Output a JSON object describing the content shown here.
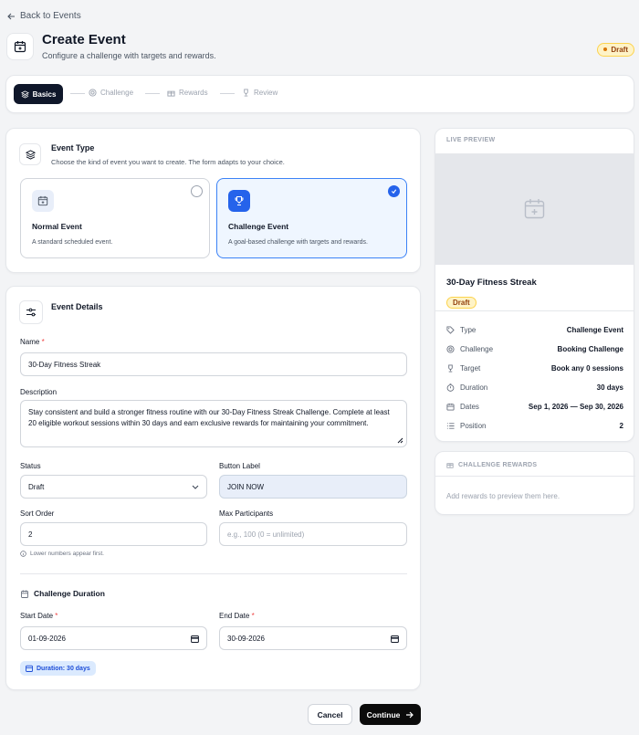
{
  "nav": {
    "back_label": "Back to Events"
  },
  "header": {
    "title": "Create Event",
    "subtitle": "Configure a challenge with targets and rewards.",
    "status_badge": "Draft"
  },
  "steps": [
    {
      "label": "Basics",
      "active": true
    },
    {
      "label": "Challenge",
      "active": false
    },
    {
      "label": "Rewards",
      "active": false
    },
    {
      "label": "Review",
      "active": false
    }
  ],
  "event_type": {
    "title": "Event Type",
    "subtitle": "Choose the kind of event you want to create. The form adapts to your choice.",
    "options": [
      {
        "name": "Normal Event",
        "description": "A standard scheduled event.",
        "selected": false
      },
      {
        "name": "Challenge Event",
        "description": "A goal-based challenge with targets and rewards.",
        "selected": true
      }
    ]
  },
  "details": {
    "title": "Event Details",
    "name_label": "Name",
    "name_value": "30-Day Fitness Streak",
    "description_label": "Description",
    "description_value": "Stay consistent and build a stronger fitness routine with our 30-Day Fitness Streak Challenge. Complete at least 20 eligible workout sessions within 30 days and earn exclusive rewards for maintaining your commitment.",
    "status_label": "Status",
    "status_value": "Draft",
    "button_label_label": "Button Label",
    "button_label_value": "JOIN NOW",
    "sort_order_label": "Sort Order",
    "sort_order_value": "2",
    "sort_order_hint": "Lower numbers appear first.",
    "max_participants_label": "Max Participants",
    "max_participants_placeholder": "e.g., 100 (0 = unlimited)",
    "duration_title": "Challenge Duration",
    "start_date_label": "Start Date",
    "start_date_value": "01-09-2026",
    "end_date_label": "End Date",
    "end_date_value": "30-09-2026",
    "duration_chip": "Duration: 30 days"
  },
  "actions": {
    "cancel_label": "Cancel",
    "continue_label": "Continue"
  },
  "preview": {
    "heading": "LIVE PREVIEW",
    "title": "30-Day Fitness Streak",
    "badge": "Draft",
    "rows": [
      {
        "icon": "tag-icon",
        "key": "Type",
        "value": "Challenge Event"
      },
      {
        "icon": "target-icon",
        "key": "Challenge",
        "value": "Booking Challenge"
      },
      {
        "icon": "trophy-icon",
        "key": "Target",
        "value": "Book any 0 sessions"
      },
      {
        "icon": "timer-icon",
        "key": "Duration",
        "value": "30 days"
      },
      {
        "icon": "calendar-icon",
        "key": "Dates",
        "value": "Sep 1, 2026 — Sep 30, 2026"
      },
      {
        "icon": "list-icon",
        "key": "Position",
        "value": "2"
      }
    ]
  },
  "rewards": {
    "heading": "CHALLENGE REWARDS",
    "empty_text": "Add rewards to preview them here."
  },
  "colors": {
    "accent": "#2563eb",
    "dark": "#0f172a",
    "draft_bg": "#fef3c7"
  }
}
